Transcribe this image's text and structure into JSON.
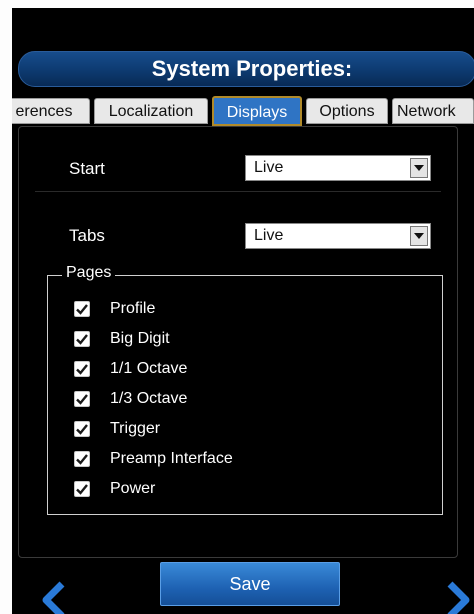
{
  "header": {
    "title": "System Properties:"
  },
  "tabs": [
    {
      "label": "erences"
    },
    {
      "label": "Localization"
    },
    {
      "label": "Displays"
    },
    {
      "label": "Options"
    },
    {
      "label": "Network"
    }
  ],
  "form": {
    "start": {
      "label": "Start",
      "value": "Live"
    },
    "tabs": {
      "label": "Tabs",
      "value": "Live"
    },
    "pages": {
      "legend": "Pages",
      "items": [
        {
          "label": "Profile",
          "checked": true
        },
        {
          "label": "Big Digit",
          "checked": true
        },
        {
          "label": "1/1 Octave",
          "checked": true
        },
        {
          "label": "1/3 Octave",
          "checked": true
        },
        {
          "label": "Trigger",
          "checked": true
        },
        {
          "label": "Preamp Interface",
          "checked": true
        },
        {
          "label": "Power",
          "checked": true
        }
      ]
    }
  },
  "footer": {
    "save_label": "Save",
    "prev_icon": "chevron-left-icon",
    "next_icon": "chevron-right-icon"
  },
  "colors": {
    "accent": "#1e62b3",
    "title_bar": "#0d3a70",
    "active_tab": "#2f74c4",
    "active_tab_border": "#b08a2a",
    "nav_arrow": "#2a7ad8"
  }
}
